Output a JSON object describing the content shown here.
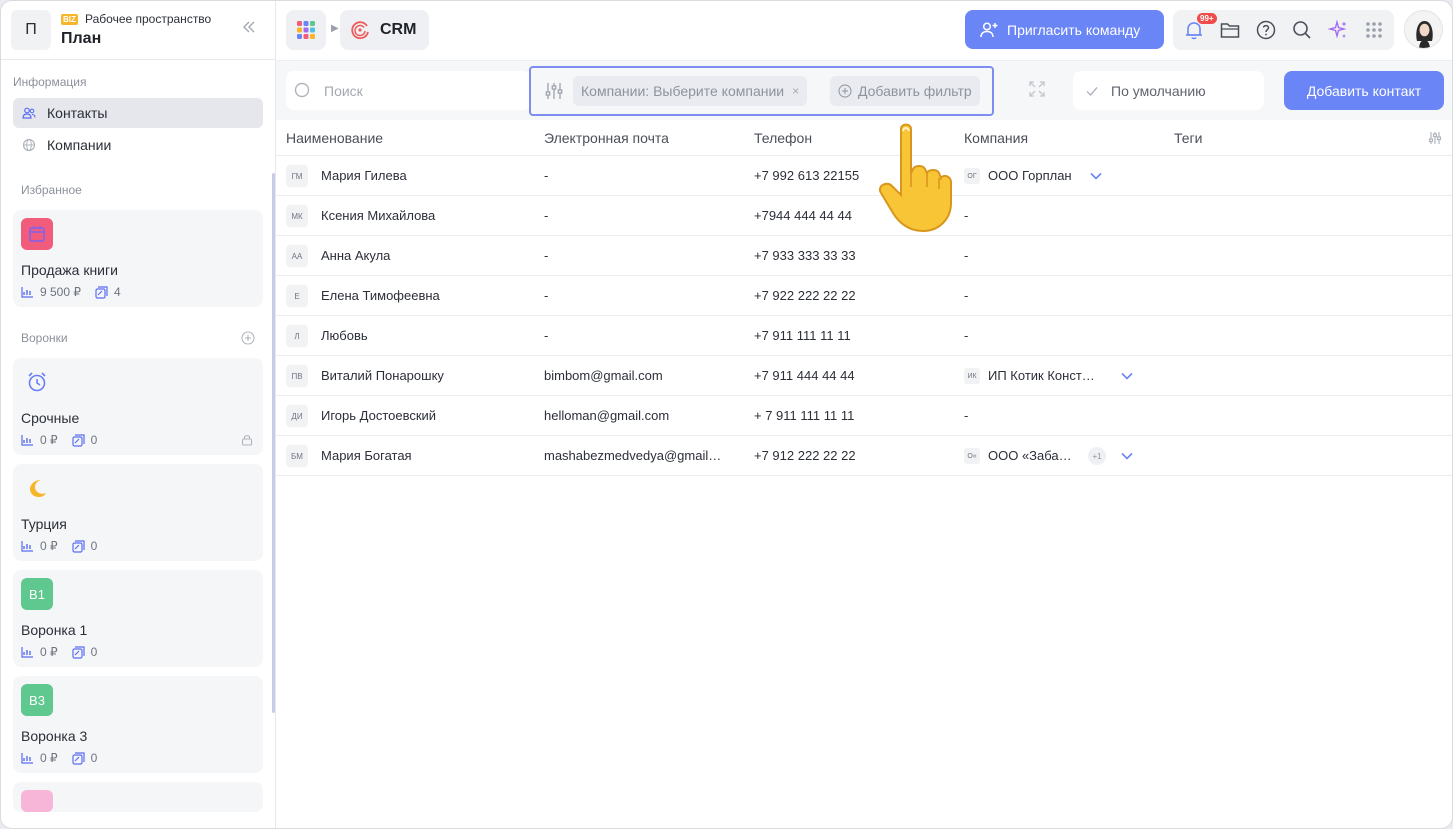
{
  "workspace": {
    "avatar_letter": "П",
    "badge": "BIZ",
    "subtitle": "Рабочее пространство",
    "title": "План"
  },
  "sidebar": {
    "info_label": "Информация",
    "nav": [
      {
        "label": "Контакты",
        "active": true
      },
      {
        "label": "Компании",
        "active": false
      }
    ],
    "favorites_label": "Избранное",
    "favorites": [
      {
        "name": "Продажа книги",
        "amount": "9 500 ₽",
        "count": "4",
        "icon": "calendar-icon",
        "color": "#f25c7c"
      }
    ],
    "funnels_label": "Воронки",
    "funnels": [
      {
        "name": "Срочные",
        "amount": "0 ₽",
        "count": "0",
        "icon": "alarm-clock-icon",
        "locked": true
      },
      {
        "name": "Турция",
        "amount": "0 ₽",
        "count": "0",
        "icon": "crescent-moon-icon",
        "locked": false
      },
      {
        "name": "Воронка 1",
        "amount": "0 ₽",
        "count": "0",
        "initials": "В1",
        "color": "#5fc88f",
        "locked": false
      },
      {
        "name": "Воронка 3",
        "amount": "0 ₽",
        "count": "0",
        "initials": "В3",
        "color": "#5fc88f",
        "locked": false
      }
    ]
  },
  "topbar": {
    "app_label": "CRM",
    "invite_label": "Пригласить команду",
    "notif_badge": "99+"
  },
  "toolbar": {
    "search_placeholder": "Поиск",
    "filter_chip": "Компании: Выберите компании",
    "add_filter": "Добавить фильтр",
    "default_view": "По умолчанию",
    "add_contact": "Добавить контакт"
  },
  "table": {
    "columns": [
      "Наименование",
      "Электронная почта",
      "Телефон",
      "Компания",
      "Теги"
    ],
    "rows": [
      {
        "initials": "ГМ",
        "name": "Мария Гилева",
        "email": "-",
        "phone": "+7 992 613 22155",
        "company_initials": "ОГ",
        "company": "ООО Горплан",
        "extra": ""
      },
      {
        "initials": "МК",
        "name": "Ксения Михайлова",
        "email": "-",
        "phone": "+7944 444 44 44",
        "company_initials": "",
        "company": "-",
        "extra": ""
      },
      {
        "initials": "АА",
        "name": "Анна Акула",
        "email": "-",
        "phone": "+7 933 333 33 33",
        "company_initials": "",
        "company": "-",
        "extra": ""
      },
      {
        "initials": "Е",
        "name": "Елена Тимофеевна",
        "email": "-",
        "phone": "+7 922 222 22 22",
        "company_initials": "",
        "company": "-",
        "extra": ""
      },
      {
        "initials": "Л",
        "name": "Любовь",
        "email": "-",
        "phone": "+7 911 111 11 11",
        "company_initials": "",
        "company": "-",
        "extra": ""
      },
      {
        "initials": "ПВ",
        "name": "Виталий Понарошку",
        "email": "bimbom@gmail.com",
        "phone": "+7 911 444 44 44",
        "company_initials": "ИК",
        "company": "ИП Котик Конст…",
        "extra": ""
      },
      {
        "initials": "ДИ",
        "name": "Игорь Достоевский",
        "email": "helloman@gmail.com",
        "phone": "+ 7 911 111 11 11",
        "company_initials": "",
        "company": "-",
        "extra": ""
      },
      {
        "initials": "БМ",
        "name": "Мария Богатая",
        "email": "mashabezmedvedya@gmail…",
        "phone": "+7 912 222 22 22",
        "company_initials": "О«",
        "company": "ООО «Заба…",
        "extra": "+1"
      }
    ]
  }
}
